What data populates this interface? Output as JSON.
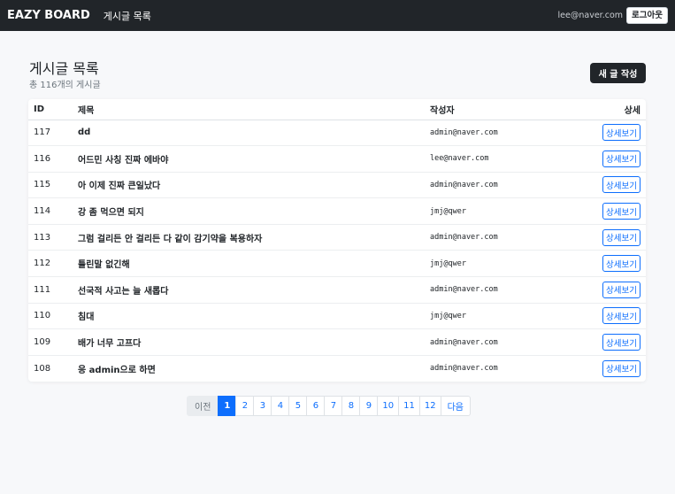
{
  "navbar": {
    "brand": "EAZY BOARD",
    "link": "게시글 목록",
    "email": "lee@naver.com",
    "logout_label": "로그아웃"
  },
  "header": {
    "title": "게시글 목록",
    "count": "총 116개의 게시글",
    "new_post_label": "새 글 작성"
  },
  "table": {
    "columns": [
      "ID",
      "제목",
      "작성자",
      "상세"
    ],
    "detail_label": "상세보기",
    "rows": [
      {
        "id": "117",
        "title": "dd",
        "author": "admin@naver.com"
      },
      {
        "id": "116",
        "title": "어드민 사칭 진짜 에바야",
        "author": "lee@naver.com"
      },
      {
        "id": "115",
        "title": "아 이제 진짜 큰일났다",
        "author": "admin@naver.com"
      },
      {
        "id": "114",
        "title": "강 좀 먹으면 되지",
        "author": "jmj@qwer"
      },
      {
        "id": "113",
        "title": "그럼 걸리든 안 걸리든 다 같이 감기약을 복용하자",
        "author": "admin@naver.com"
      },
      {
        "id": "112",
        "title": "틀린말 없긴해",
        "author": "jmj@qwer"
      },
      {
        "id": "111",
        "title": "선국적 사고는 늘 새롭다",
        "author": "admin@naver.com"
      },
      {
        "id": "110",
        "title": "침대",
        "author": "jmj@qwer"
      },
      {
        "id": "109",
        "title": "배가 너무 고프다",
        "author": "admin@naver.com"
      },
      {
        "id": "108",
        "title": "응 admin으로 하면",
        "author": "admin@naver.com"
      }
    ]
  },
  "pagination": {
    "prev_label": "이전",
    "next_label": "다음",
    "pages": [
      "1",
      "2",
      "3",
      "4",
      "5",
      "6",
      "7",
      "8",
      "9",
      "10",
      "11",
      "12"
    ],
    "current": "1"
  }
}
